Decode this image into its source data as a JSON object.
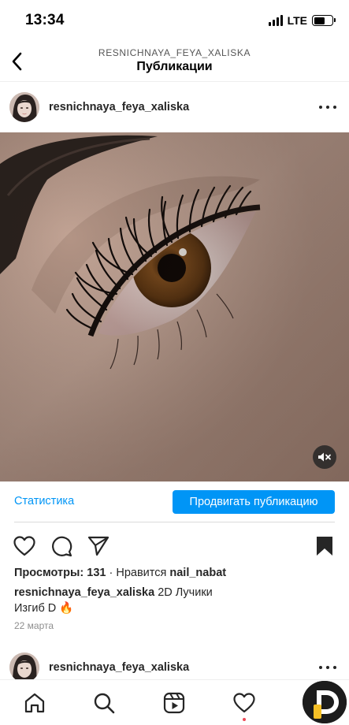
{
  "status_bar": {
    "time": "13:34",
    "network": "LTE",
    "battery_level": 0.6
  },
  "header": {
    "subtitle": "RESNICHNAYA_FEYA_XALISKA",
    "title": "Публикации"
  },
  "post": {
    "username": "resnichnaya_feya_xaliska",
    "media": {
      "description_icon": "eye-photo",
      "muted": true
    },
    "statistics_label": "Статистика",
    "promote_label": "Продвигать публикацию",
    "views_label": "Просмотры:",
    "views_count": "131",
    "separator": "·",
    "liked_by_prefix": "Нравится",
    "liked_by_user": "nail_nabat",
    "caption_user": "resnichnaya_feya_xaliska",
    "caption_text": "2D Лучики",
    "caption_line2": "Изгиб D",
    "caption_emoji": "🔥",
    "date": "22 марта"
  },
  "next_post": {
    "username": "resnichnaya_feya_xaliska"
  },
  "tab_bar": {
    "items": [
      "home-icon",
      "search-icon",
      "reels-icon",
      "activity-icon",
      "profile-icon"
    ],
    "activity_has_notification": true
  },
  "colors": {
    "accent": "#0095f6",
    "text": "#262626",
    "muted": "#8e8e8e",
    "notification": "#ed4956"
  }
}
